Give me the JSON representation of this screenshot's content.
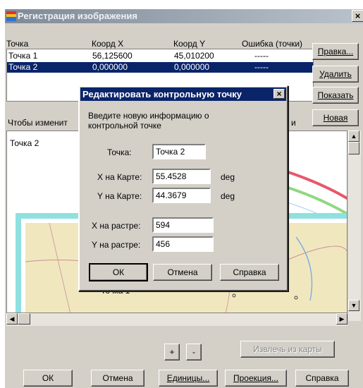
{
  "window": {
    "title": "Регистрация изображения",
    "close": "×"
  },
  "list": {
    "headers": [
      "Точка",
      "Коорд X",
      "Коорд Y",
      "Ошибка (точки)"
    ],
    "rows": [
      {
        "name": "Точка 1",
        "x": "56,125600",
        "y": "45,010200",
        "err": "-----"
      },
      {
        "name": "Точка 2",
        "x": "0,000000",
        "y": "0,000000",
        "err": "-----"
      }
    ]
  },
  "side_buttons": {
    "edit": "Правка...",
    "delete": "Удалить",
    "show": "Показать",
    "new": "Новая"
  },
  "hint": "Чтобы изменит",
  "hint_right": "и",
  "map": {
    "label_point2": "Точка 2",
    "label_point1": "Точка 1",
    "colors": {
      "frame": "#7fe0e0",
      "band_red": "#e8586a",
      "band_green": "#8fd880",
      "land": "#f2e6b8"
    }
  },
  "bottom": {
    "plus": "+",
    "minus": "-",
    "extract": "Извлечь из карты",
    "ok": "ОК",
    "cancel": "Отмена",
    "units": "Единицы...",
    "projection": "Проекция...",
    "help": "Справка"
  },
  "dialog": {
    "title": "Редактировать контрольную точку",
    "close": "×",
    "prompt_line1": "Введите новую информацию о",
    "prompt_line2": "контрольной точке",
    "point_label": "Точка:",
    "point_value": "Точка 2",
    "xmap_label": "X на Карте:",
    "xmap_value": "55.4528",
    "ymap_label": "Y на Карте:",
    "ymap_value": "44.3679",
    "unit": "deg",
    "xr_label": "X на растре:",
    "xr_value": "594",
    "yr_label": "Y на растре:",
    "yr_value": "456",
    "ok": "ОК",
    "cancel": "Отмена",
    "help": "Справка"
  }
}
